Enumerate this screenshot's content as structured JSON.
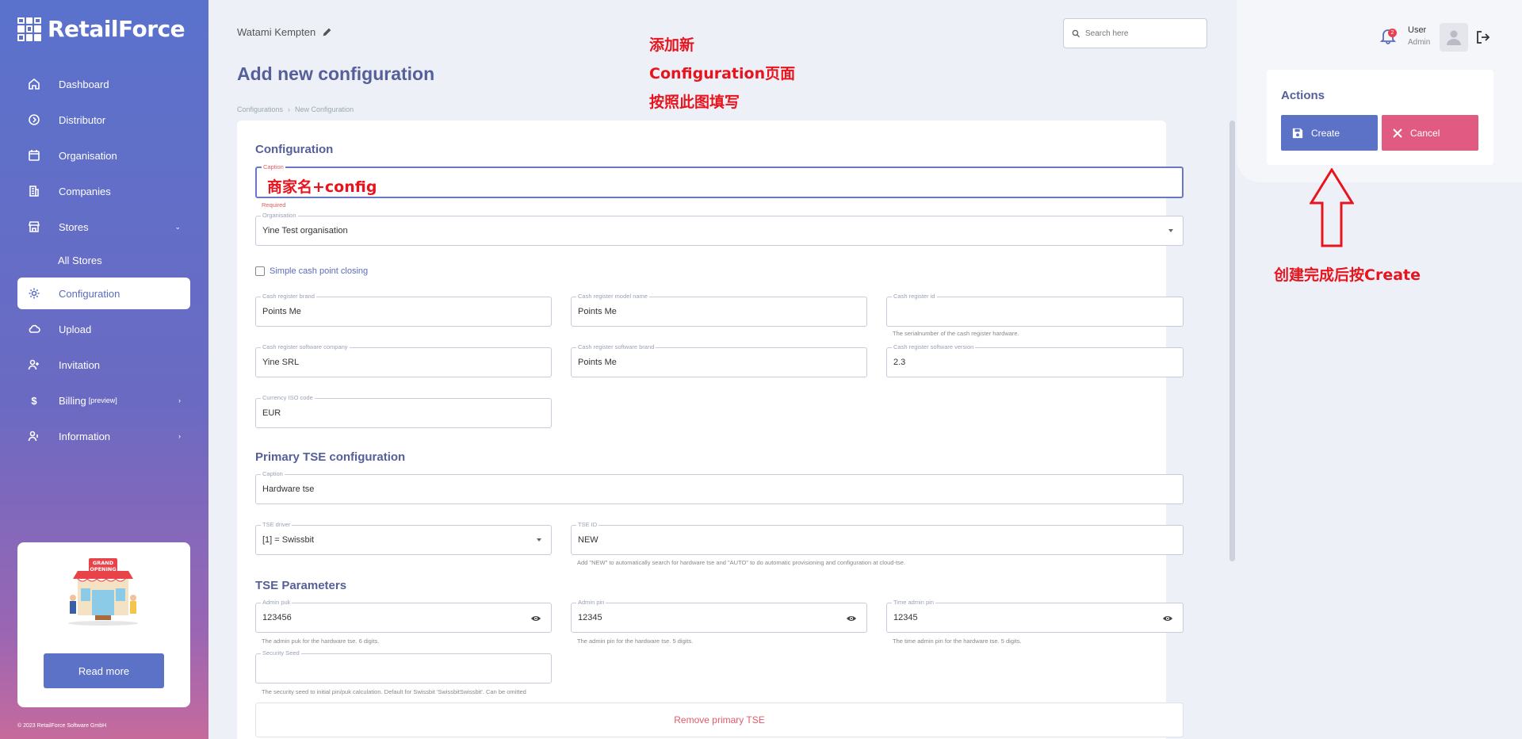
{
  "brand": {
    "name": "RetailForce"
  },
  "sidebar": {
    "items": [
      {
        "label": "Dashboard",
        "icon": "home-icon"
      },
      {
        "label": "Distributor",
        "icon": "distributor-icon"
      },
      {
        "label": "Organisation",
        "icon": "calendar-icon"
      },
      {
        "label": "Companies",
        "icon": "building-icon"
      },
      {
        "label": "Stores",
        "icon": "store-icon"
      },
      {
        "label": "All Stores"
      },
      {
        "label": "Configuration",
        "icon": "gear-icon"
      },
      {
        "label": "Upload",
        "icon": "cloud-icon"
      },
      {
        "label": "Invitation",
        "icon": "user-plus-icon"
      },
      {
        "label": "Billing",
        "badge": "[preview]",
        "icon": "dollar-icon"
      },
      {
        "label": "Information",
        "icon": "user-info-icon"
      }
    ],
    "promo": {
      "button": "Read more",
      "sign_line1": "GRAND",
      "sign_line2": "OPENING"
    },
    "copyright": "© 2023 RetailForce Software GmbH"
  },
  "header": {
    "store_name": "Watami Kempten",
    "page_title": "Add new configuration",
    "breadcrumb": [
      "Configurations",
      "New Configuration"
    ],
    "search_placeholder": "Search here"
  },
  "annotations": {
    "top_line1": "添加新",
    "top_line2": "Configuration页面",
    "top_line3": "按照此图填写",
    "caption_value": "商家名+config",
    "create_hint": "创建完成后按Create"
  },
  "form": {
    "section_configuration": "Configuration",
    "caption_label": "Caption",
    "caption_error": "Required",
    "organisation_label": "Organisation",
    "organisation_value": "Yine Test organisation",
    "simple_closing_label": "Simple cash point closing",
    "cr_brand_label": "Cash register brand",
    "cr_brand_value": "Points Me",
    "cr_model_label": "Cash register model name",
    "cr_model_value": "Points Me",
    "cr_id_label": "Cash register id",
    "cr_id_value": "",
    "cr_id_hint": "The serialnumber of the cash register hardware.",
    "sw_company_label": "Cash register software company",
    "sw_company_value": "Yine SRL",
    "sw_brand_label": "Cash register software brand",
    "sw_brand_value": "Points Me",
    "sw_version_label": "Cash register software version",
    "sw_version_value": "2.3",
    "currency_label": "Currency ISO code",
    "currency_value": "EUR",
    "section_primary_tse": "Primary TSE configuration",
    "tse_caption_label": "Caption",
    "tse_caption_value": "Hardware tse",
    "tse_driver_label": "TSE driver",
    "tse_driver_value": "[1] = Swissbit",
    "tse_id_label": "TSE ID",
    "tse_id_value": "NEW",
    "tse_id_hint": "Add \"NEW\" to automatically search for hardware tse and \"AUTO\" to do automatic provisioning and configuration at cloud-tse.",
    "section_tse_params": "TSE Parameters",
    "admin_puk_label": "Admin puk",
    "admin_puk_value": "123456",
    "admin_puk_hint": "The admin puk for the hardware tse. 6 digits.",
    "admin_pin_label": "Admin pin",
    "admin_pin_value": "12345",
    "admin_pin_hint": "The admin pin for the hardware tse. 5 digits.",
    "time_admin_pin_label": "Time admin pin",
    "time_admin_pin_value": "12345",
    "time_admin_pin_hint": "The time admin pin for the hardware tse. 5 digits.",
    "security_seed_label": "Security Seed",
    "security_seed_value": "",
    "security_seed_hint": "The security seed to initial pin/puk calculation. Default for Swissbit 'SwissbitSwissbit'. Can be omitted",
    "remove_primary_tse": "Remove primary TSE"
  },
  "user": {
    "name": "User",
    "role": "Admin",
    "notifications": "2"
  },
  "actions": {
    "title": "Actions",
    "create": "Create",
    "cancel": "Cancel"
  },
  "colors": {
    "primary": "#5b72c7",
    "danger": "#e05a82",
    "annotation": "#e8141d"
  }
}
